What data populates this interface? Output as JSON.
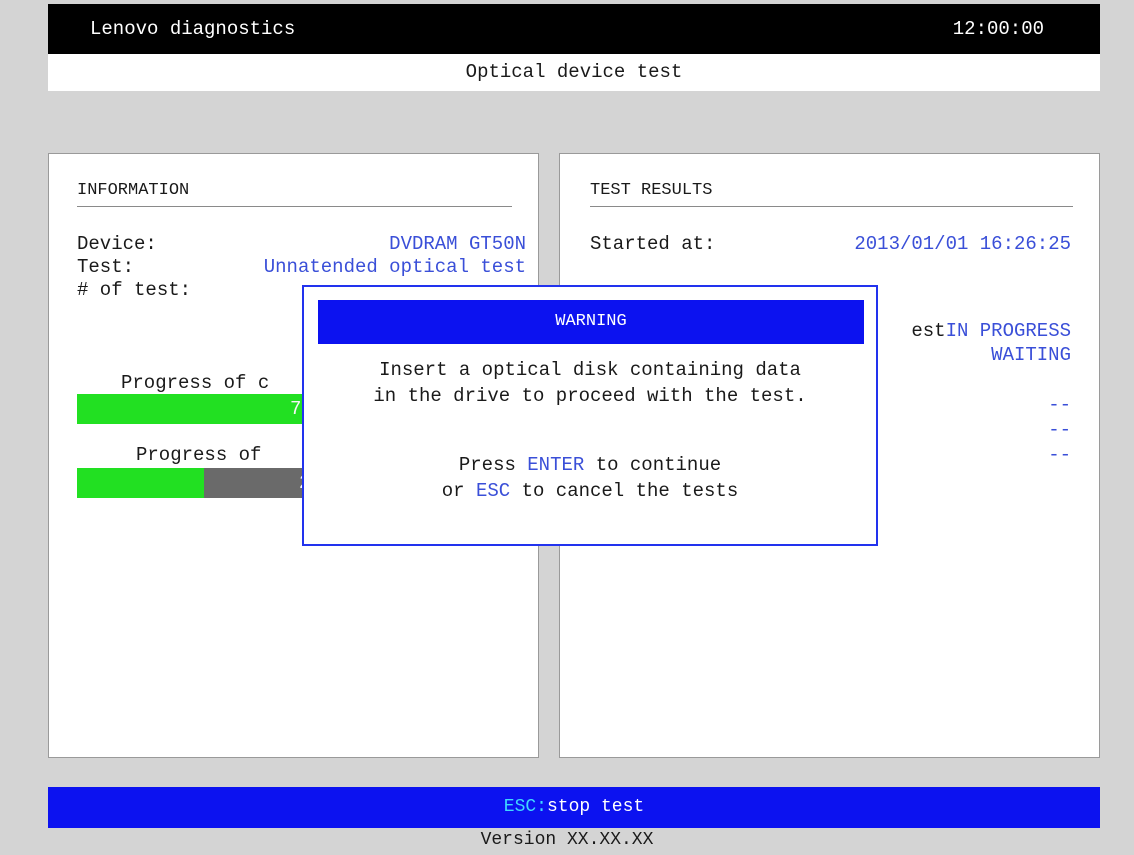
{
  "header": {
    "app_title": "Lenovo diagnostics",
    "clock": "12:00:00",
    "page_title": "Optical device test"
  },
  "information": {
    "heading": "INFORMATION",
    "device_label": "Device:",
    "device_value": "DVDRAM GT50N",
    "test_label": "Test:",
    "test_value": "Unnatended optical test",
    "num_test_label": "# of test:",
    "progress1_label": "Progress of c",
    "progress1_pct": "75",
    "progress1_value": 0.75,
    "progress2_label": "Progress of",
    "progress2_pct": "28",
    "progress2_value": 0.28
  },
  "results": {
    "heading": "TEST RESULTS",
    "started_label": "Started at:",
    "started_value": "2013/01/01 16:26:25",
    "row1_label_partial": "est",
    "row1_status": "IN PROGRESS",
    "row2_status": "WAITING",
    "dash1": "--",
    "dash2": "--",
    "dash3": "--"
  },
  "modal": {
    "title": "WARNING",
    "line1": "Insert a optical disk containing data",
    "line2": "in the drive to proceed with the test.",
    "press_prefix": "Press ",
    "enter_key": "ENTER",
    "press_suffix": " to continue",
    "or_prefix": "or ",
    "esc_key": "ESC",
    "or_suffix": " to cancel the tests"
  },
  "footer": {
    "key": "ESC:",
    "action": "stop test",
    "version": "Version XX.XX.XX"
  },
  "colors": {
    "accent_blue": "#0c12f0",
    "value_blue": "#3a4fd8",
    "progress_green": "#22e022"
  }
}
